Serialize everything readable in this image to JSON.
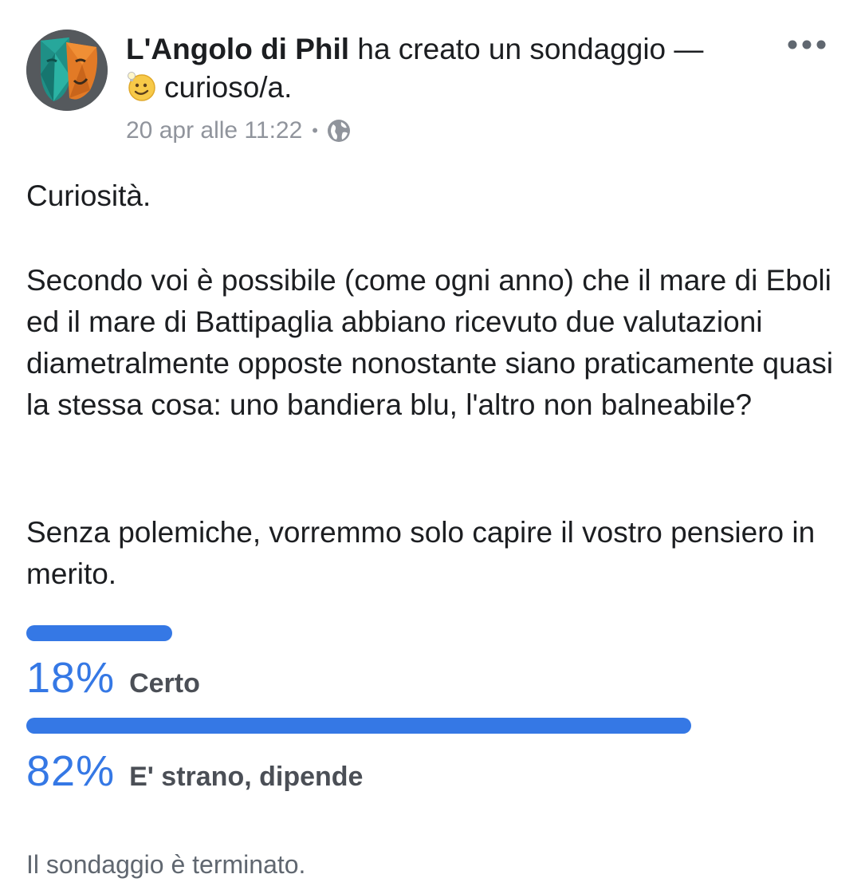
{
  "post": {
    "author": "L'Angolo di Phil",
    "action_text": " ha creato un sondaggio — ",
    "activity": "curioso/a.",
    "activity_icon": "smiling-face-with-lightbulb-icon",
    "timestamp": "20 apr alle 11:22",
    "separator": "•",
    "privacy_icon": "globe-icon",
    "more_icon": "more-dots-icon",
    "paragraphs": [
      "Curiosità.",
      "Secondo voi è possibile (come ogni anno) che il mare di Eboli ed il mare di Battipaglia abbiano ricevuto due valutazioni diametralmente opposte nonostante siano praticamente quasi la stessa cosa: uno bandiera blu, l'altro non balneabile?",
      "Senza polemiche, vorremmo solo capire il vostro pensiero in merito."
    ]
  },
  "poll": {
    "accent_color": "#3578e5",
    "options": [
      {
        "percent": 18,
        "percent_label": "18%",
        "label": "Certo"
      },
      {
        "percent": 82,
        "percent_label": "82%",
        "label": "E' strano, dipende"
      }
    ],
    "status": "Il sondaggio è terminato."
  }
}
